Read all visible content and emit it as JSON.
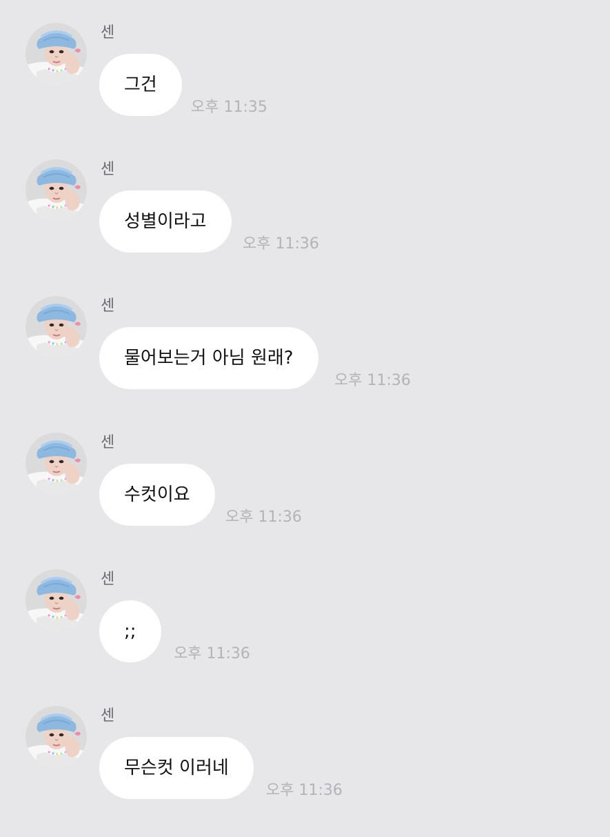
{
  "conversation": {
    "messages": [
      {
        "sender": "센",
        "text": "그건",
        "time": "오후 11:35"
      },
      {
        "sender": "센",
        "text": "성별이라고",
        "time": "오후 11:36"
      },
      {
        "sender": "센",
        "text": "물어보는거 아님 원래?",
        "time": "오후 11:36"
      },
      {
        "sender": "센",
        "text": "수컷이요",
        "time": "오후 11:36"
      },
      {
        "sender": "센",
        "text": ";;",
        "time": "오후 11:36"
      },
      {
        "sender": "센",
        "text": "무슨컷 이러네",
        "time": "오후 11:36"
      }
    ]
  },
  "colors": {
    "background": "#e7e7e9",
    "bubble": "#ffffff",
    "sender_name": "#6a6a70",
    "timestamp": "#b3b3b8"
  },
  "icons": {
    "avatar": "profile-photo"
  }
}
